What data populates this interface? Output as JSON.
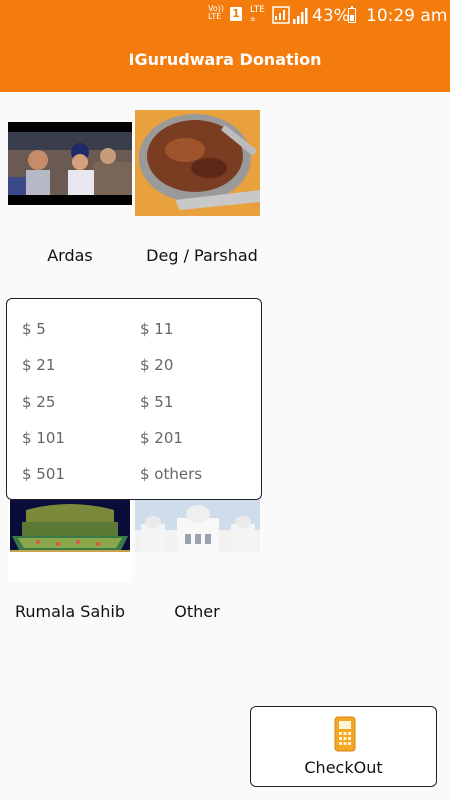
{
  "status_bar": {
    "volte_line1": "Vo))",
    "volte_line2": "LTE",
    "sim_slot": "1",
    "network": "LTE",
    "network_sub": "±",
    "battery": "43%",
    "time": "10:29 am",
    "battery_level": 0.43
  },
  "app_bar": {
    "title": "IGurudwara Donation"
  },
  "tiles": [
    {
      "label": "Ardas"
    },
    {
      "label": "Deg / Parshad"
    },
    {
      "label": "Rumala Sahib"
    },
    {
      "label": "Other"
    }
  ],
  "amounts": [
    "$ 5",
    "$ 11",
    "$ 21",
    "$ 20",
    "$ 25",
    "$ 51",
    "$ 101",
    "$ 201",
    "$ 501",
    "$ others"
  ],
  "checkout": {
    "label": "CheckOut",
    "icon": "card-terminal-icon"
  },
  "colors": {
    "primary": "#f47c0c",
    "text": "#111111",
    "amount_text": "#666666"
  }
}
